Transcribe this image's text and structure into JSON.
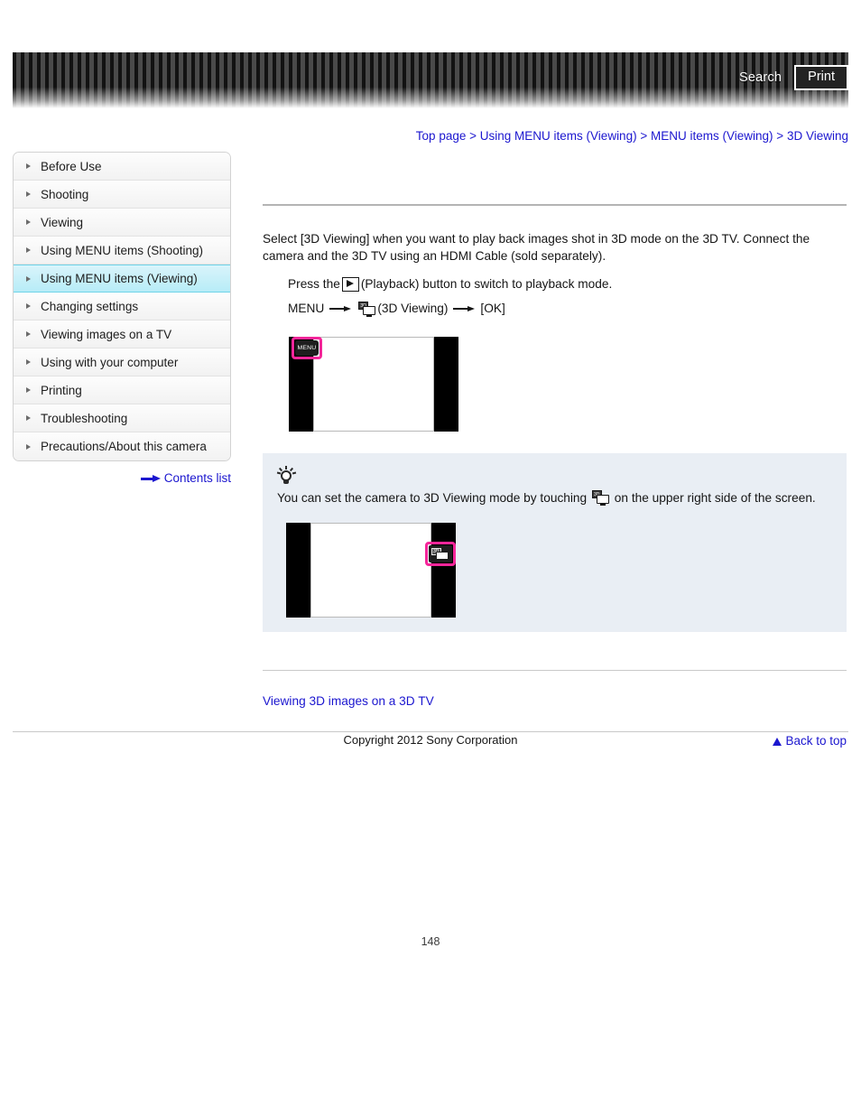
{
  "header": {
    "search_label": "Search",
    "print_label": "Print"
  },
  "breadcrumb": {
    "items": [
      {
        "label": "Top page"
      },
      {
        "label": "Using MENU items (Viewing)"
      },
      {
        "label": "MENU items (Viewing)"
      },
      {
        "label": "3D Viewing"
      }
    ],
    "separator": ">"
  },
  "sidebar": {
    "items": [
      {
        "label": "Before Use",
        "active": false
      },
      {
        "label": "Shooting",
        "active": false
      },
      {
        "label": "Viewing",
        "active": false
      },
      {
        "label": "Using MENU items (Shooting)",
        "active": false
      },
      {
        "label": "Using MENU items (Viewing)",
        "active": true
      },
      {
        "label": "Changing settings",
        "active": false
      },
      {
        "label": "Viewing images on a TV",
        "active": false
      },
      {
        "label": "Using with your computer",
        "active": false
      },
      {
        "label": "Printing",
        "active": false
      },
      {
        "label": "Troubleshooting",
        "active": false
      },
      {
        "label": "Precautions/About this camera",
        "active": false
      }
    ],
    "contents_list_label": "Contents list"
  },
  "main": {
    "intro": "Select [3D Viewing] when you want to play back images shot in 3D mode on the 3D TV. Connect the camera and the 3D TV using an HDMI Cable (sold separately).",
    "step1_before": "Press the",
    "step1_after": "(Playback) button to switch to playback mode.",
    "step2_menu": "MENU",
    "step2_item": "(3D Viewing)",
    "step2_ok": "[OK]",
    "illustration1": {
      "menu_chip_label": "MENU"
    },
    "tip": {
      "text_before": "You can set the camera to 3D Viewing mode by touching",
      "text_after": "on the upper right side of the screen.",
      "icon_3d_label": "3D"
    },
    "related_link": "Viewing 3D images on a 3D TV",
    "back_to_top": "Back to top"
  },
  "footer": {
    "copyright": "Copyright 2012 Sony Corporation",
    "page_number": "148"
  }
}
